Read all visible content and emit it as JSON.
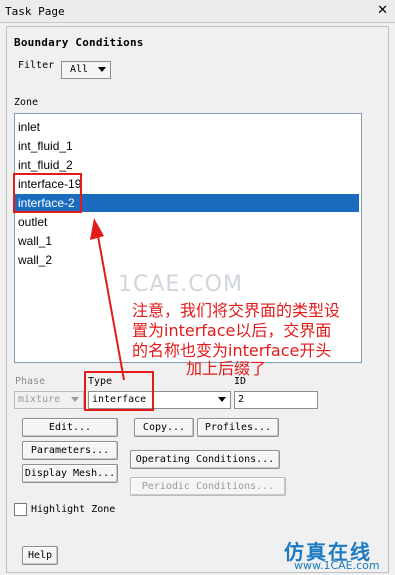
{
  "window": {
    "title": "Task Page",
    "close_glyph": "✕"
  },
  "heading": "Boundary Conditions",
  "filter": {
    "label": "Filter",
    "value": "All"
  },
  "zone": {
    "label": "Zone",
    "items": [
      "inlet",
      "int_fluid_1",
      "int_fluid_2",
      "interface-19",
      "interface-2",
      "outlet",
      "wall_1",
      "wall_2"
    ],
    "selected_index": 4
  },
  "phase": {
    "label": "Phase",
    "value": "mixture"
  },
  "type": {
    "label": "Type",
    "value": "interface"
  },
  "id": {
    "label": "ID",
    "value": "2"
  },
  "buttons": {
    "edit": "Edit...",
    "copy": "Copy...",
    "profiles": "Profiles...",
    "parameters": "Parameters...",
    "operating": "Operating Conditions...",
    "display_mesh": "Display Mesh...",
    "periodic": "Periodic Conditions...",
    "help": "Help"
  },
  "highlight_zone": {
    "label": "Highlight Zone",
    "checked": false
  },
  "annotation": {
    "line1": "注意，我们将交界面的类型设",
    "line2": "置为interface以后，交界面",
    "line3": "的名称也变为interface开头",
    "line4": "加上后缀了"
  },
  "watermark": "1CAE.COM",
  "brand": {
    "name": "仿真在线",
    "url": "www.1CAE.com"
  },
  "colors": {
    "selection": "#1b6cbf",
    "annotation": "#e21a1a",
    "brand": "#1a7ac2"
  }
}
